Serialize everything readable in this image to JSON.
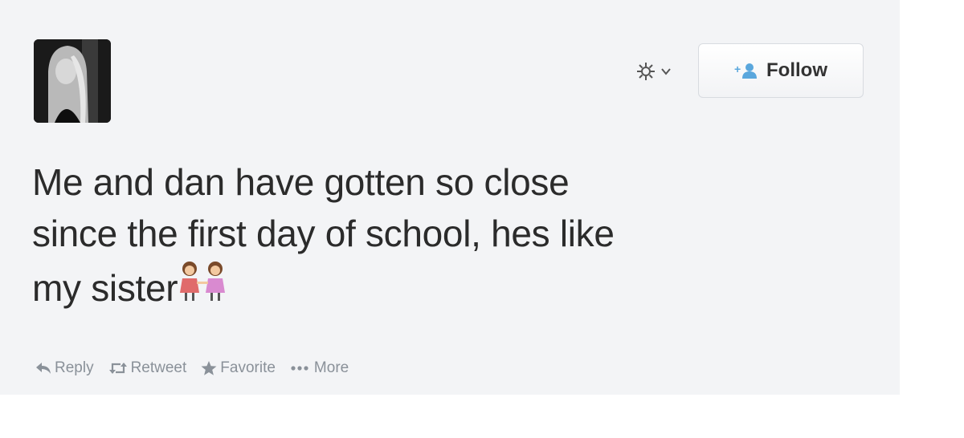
{
  "tweet": {
    "text_line1": "Me and dan have gotten so close",
    "text_line2": "since the first day of school, hes like",
    "text_line3": "my sister",
    "emoji": "two-women-holding-hands"
  },
  "header": {
    "follow_label": "Follow",
    "settings_icon": "gear-icon",
    "dropdown_icon": "chevron-down-icon",
    "follow_icon": "add-user-icon"
  },
  "actions": {
    "reply": "Reply",
    "retweet": "Retweet",
    "favorite": "Favorite",
    "more": "More"
  },
  "colors": {
    "card_background": "#f3f4f6",
    "text": "#2b2b2b",
    "action_gray": "#8a9199",
    "follow_icon_blue": "#5aa7dd"
  }
}
